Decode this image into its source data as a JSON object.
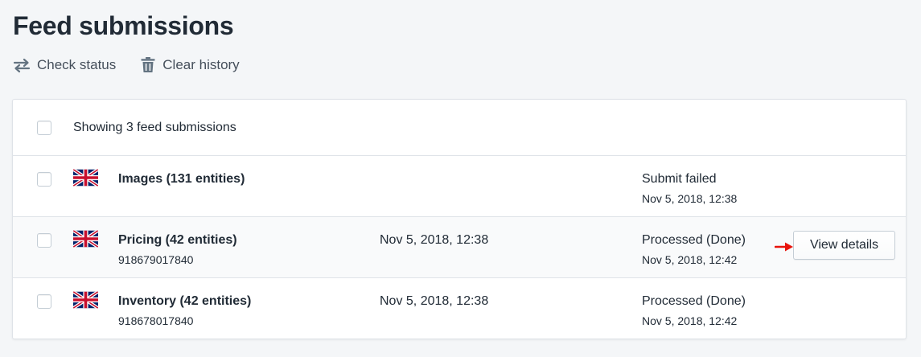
{
  "page": {
    "title": "Feed submissions"
  },
  "actions": {
    "check_status": "Check status",
    "clear_history": "Clear history"
  },
  "list": {
    "summary": "Showing 3 feed submissions",
    "rows": [
      {
        "name": "Images (131 entities)",
        "submission_id": "",
        "submitted_at": "",
        "status": "Submit failed",
        "status_time": "Nov 5, 2018, 12:38",
        "flag": "uk-flag-icon"
      },
      {
        "name": "Pricing (42 entities)",
        "submission_id": "918679017840",
        "submitted_at": "Nov 5, 2018, 12:38",
        "status": "Processed (Done)",
        "status_time": "Nov 5, 2018, 12:42",
        "flag": "uk-flag-icon",
        "action_label": "View details"
      },
      {
        "name": "Inventory (42 entities)",
        "submission_id": "918678017840",
        "submitted_at": "Nov 5, 2018, 12:38",
        "status": "Processed (Done)",
        "status_time": "Nov 5, 2018, 12:42",
        "flag": "uk-flag-icon"
      }
    ]
  },
  "colors": {
    "background": "#f4f6f8",
    "text": "#212b36",
    "border": "#dfe3e8",
    "annotation_arrow": "#e8140c"
  },
  "icons": {
    "check_status": "swap-arrows-icon",
    "clear_history": "trash-icon",
    "annotation": "red-arrow-icon"
  }
}
